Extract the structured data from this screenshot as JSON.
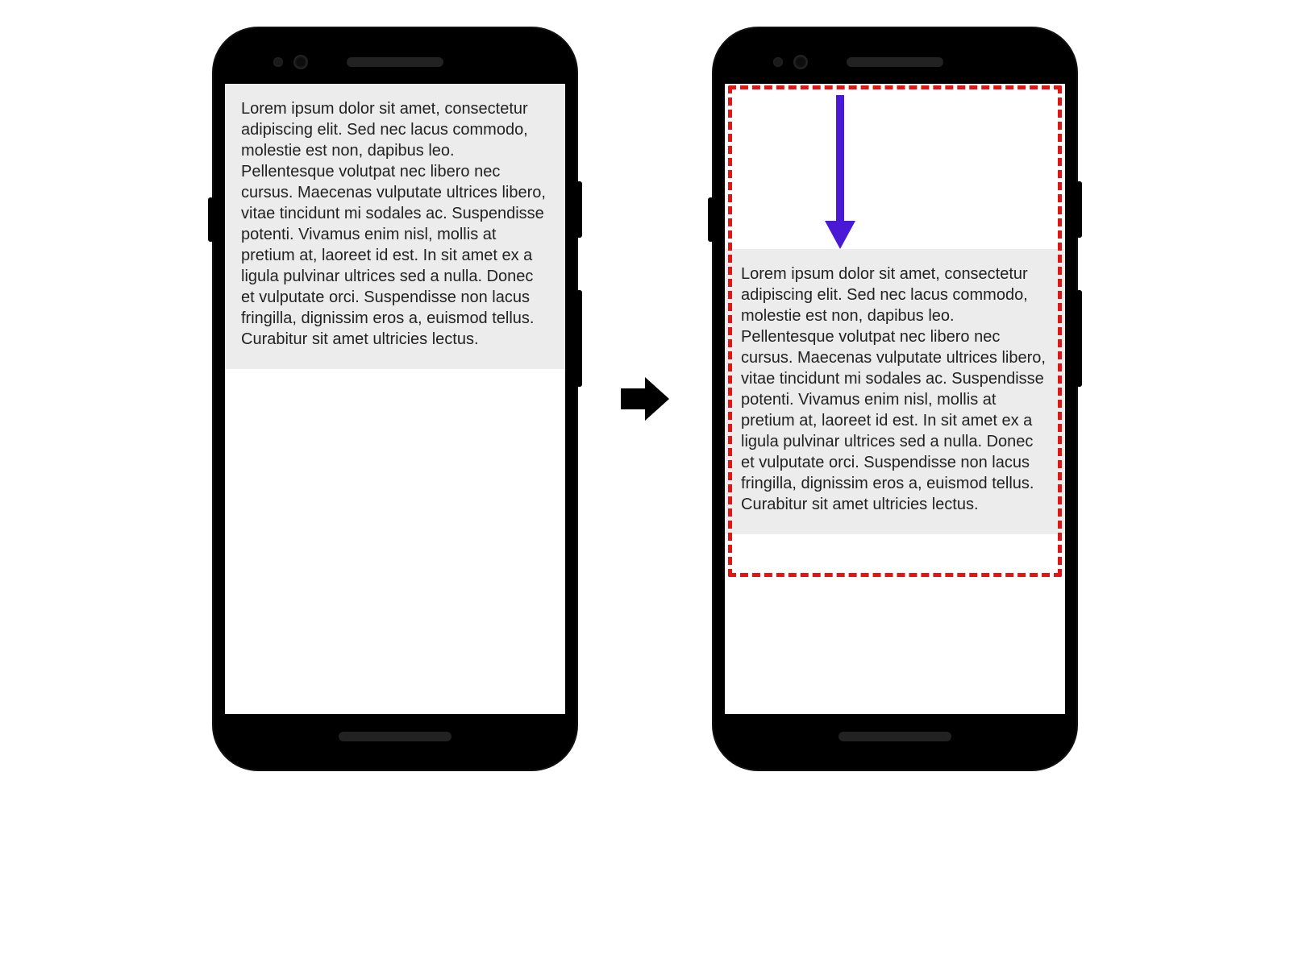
{
  "content": {
    "lorem": "Lorem ipsum dolor sit amet, consectetur adipiscing elit. Sed nec lacus commodo, molestie est non, dapibus leo. Pellentesque volutpat nec libero nec cursus. Maecenas vulputate ultrices libero, vitae tincidunt mi sodales ac. Suspendisse potenti. Vivamus enim nisl, mollis at pretium at, laoreet id est. In sit amet ex a ligula pulvinar ultrices sed a nulla. Donec et vulputate orci. Suspendisse non lacus fringilla, dignissim eros a, euismod tellus. Curabitur sit amet ultricies lectus."
  },
  "colors": {
    "highlight_border": "#e01515",
    "scroll_arrow": "#4a19d6",
    "text_bg": "#ececec"
  },
  "diagram": {
    "meaning": "before-and-after of content offset/scroll within viewport",
    "direction_arrow": "right",
    "scroll_arrow": "down"
  }
}
